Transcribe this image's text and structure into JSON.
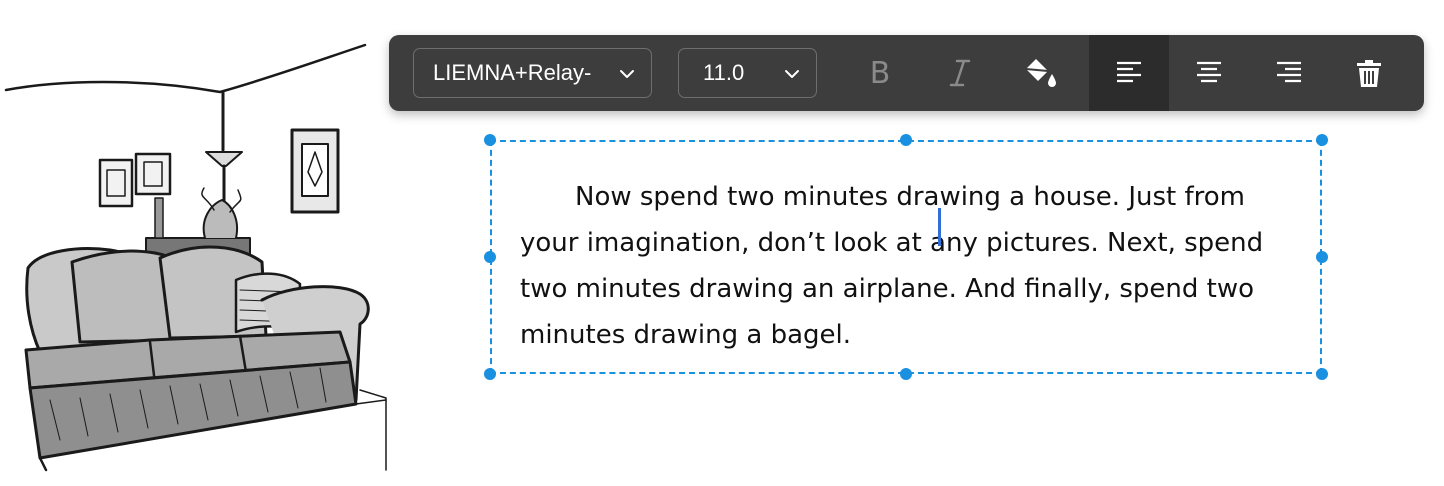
{
  "toolbar": {
    "font_family": "LIEMNA+Relay-",
    "font_size": "11.0",
    "bold_label": "B",
    "alignment_selected": "left"
  },
  "icons": {
    "font_dropdown": "chevron-down-icon",
    "size_dropdown": "chevron-down-icon",
    "italic": "italic-icon",
    "fill": "paint-bucket-icon",
    "align_left": "align-left-icon",
    "align_center": "align-center-icon",
    "align_right": "align-right-icon",
    "delete": "trash-icon"
  },
  "text_box": {
    "content": "Now spend two minutes drawing a house. Just from your imagination, don’t look at any pictures. Next, spend two minutes drawing an airplane. And finally, spend two minutes drawing a bagel."
  },
  "colors": {
    "toolbar_bg": "#3d3d3d",
    "active_button_bg": "#2c2c2c",
    "selection_blue": "#1a90e0",
    "caret_blue": "#2f6fd6"
  }
}
